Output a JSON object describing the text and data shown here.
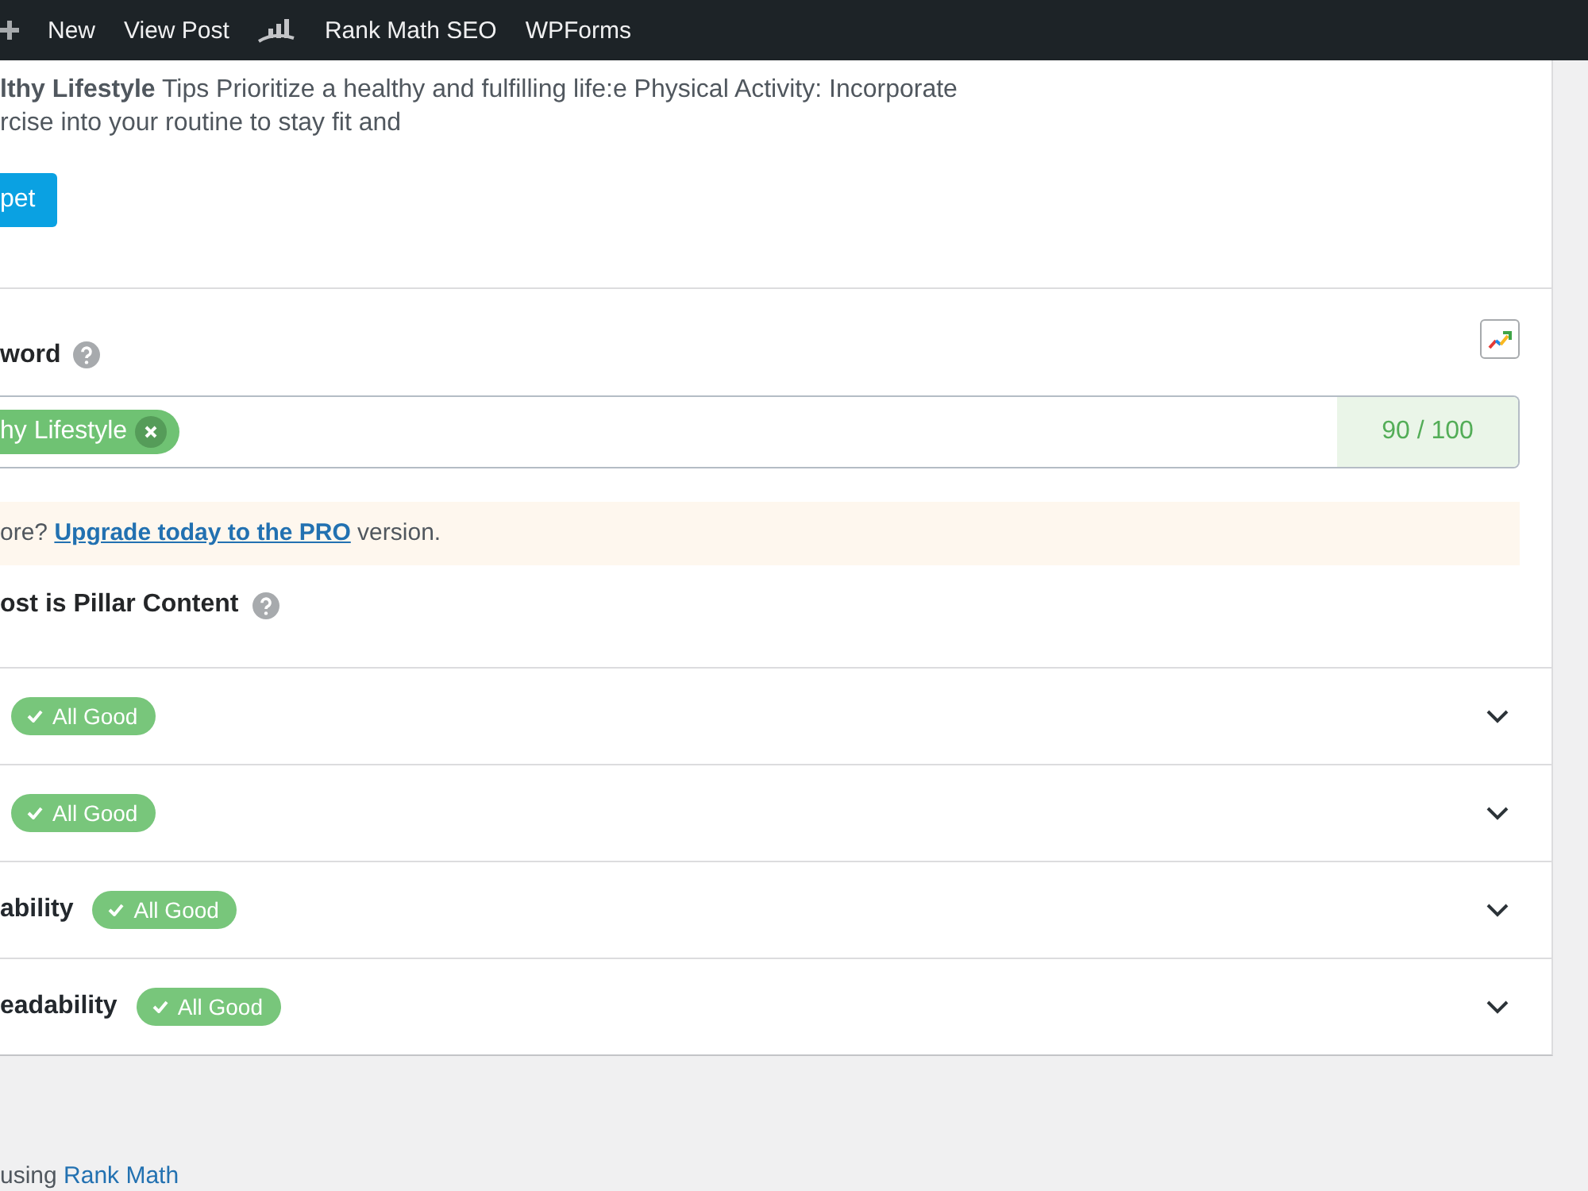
{
  "admin_bar": {
    "items": [
      {
        "kind": "new",
        "label": "New"
      },
      {
        "kind": "link",
        "label": "View Post"
      },
      {
        "kind": "rank_math",
        "label": "Rank Math SEO"
      },
      {
        "kind": "link",
        "label": "WPForms"
      }
    ]
  },
  "snippet_preview": {
    "description_lines": [
      "**lthy Lifestyle** Tips Prioritize a healthy and fulfilling life:e Physical Activity: Incorporate",
      "rcise into your routine to stay fit and"
    ],
    "button": "pet"
  },
  "focus_keyword": {
    "label": "word",
    "keywords": [
      {
        "text": "hy Lifestyle"
      }
    ],
    "score": "90 / 100"
  },
  "upgrade_notice": {
    "text_before": "ore? ",
    "link": "Upgrade today to the PRO",
    "text_after": " version."
  },
  "pillar_content": {
    "label": "ost is Pillar Content"
  },
  "sections": [
    {
      "status": "All Good",
      "expanded": false
    },
    {
      "status": "All Good",
      "expanded": false
    },
    {
      "title": "ability",
      "status": "All Good",
      "expanded": false
    },
    {
      "title": "eadability",
      "status": "All Good",
      "expanded": false
    }
  ],
  "footer": {
    "text_before": "using ",
    "link": "Rank Math"
  }
}
